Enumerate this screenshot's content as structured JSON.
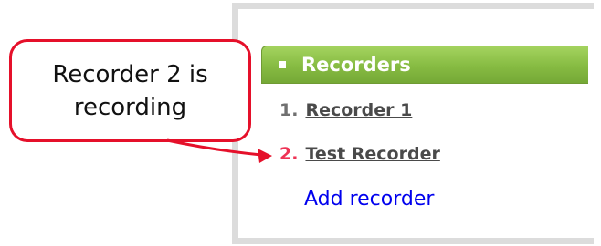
{
  "callout": {
    "line1": "Recorder 2 is",
    "line2": "recording"
  },
  "panel": {
    "header_title": "Recorders",
    "recorders": [
      {
        "number": "1.",
        "name": "Recorder 1",
        "status": "idle"
      },
      {
        "number": "2.",
        "name": "Test Recorder",
        "status": "recording"
      }
    ],
    "add_label": "Add recorder"
  },
  "colors": {
    "header_green": "#86bb42",
    "recording_red": "#ee3355",
    "callout_red": "#e5102a",
    "link_blue": "#0000ee",
    "panel_border": "#dcdcdc"
  }
}
